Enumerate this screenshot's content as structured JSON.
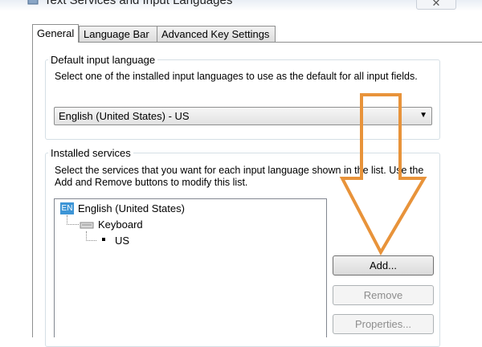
{
  "window": {
    "title": "Text Services and Input Languages",
    "close_glyph": "✕"
  },
  "tabs": [
    {
      "label": "General",
      "active": true
    },
    {
      "label": "Language Bar",
      "active": false
    },
    {
      "label": "Advanced Key Settings",
      "active": false
    }
  ],
  "default_group": {
    "legend": "Default input language",
    "description": "Select one of the installed input languages to use as the default for all input fields.",
    "selected_value": "English (United States) - US"
  },
  "installed_group": {
    "legend": "Installed services",
    "description": "Select the services that you want for each input language shown in the list. Use the Add and Remove buttons to modify this list."
  },
  "tree": {
    "language_badge": "EN",
    "language": "English (United States)",
    "category": "Keyboard",
    "layout": "US"
  },
  "buttons": {
    "add": "Add...",
    "remove": "Remove",
    "properties": "Properties..."
  },
  "colors": {
    "annotation_arrow": "#e8933a",
    "badge": "#3d95d6"
  },
  "icons": {
    "window": "keyboard-icon",
    "tree_keyboard": "keyboard-icon",
    "annotation": "arrow-down-icon",
    "dropdown": "chevron-down-icon"
  }
}
